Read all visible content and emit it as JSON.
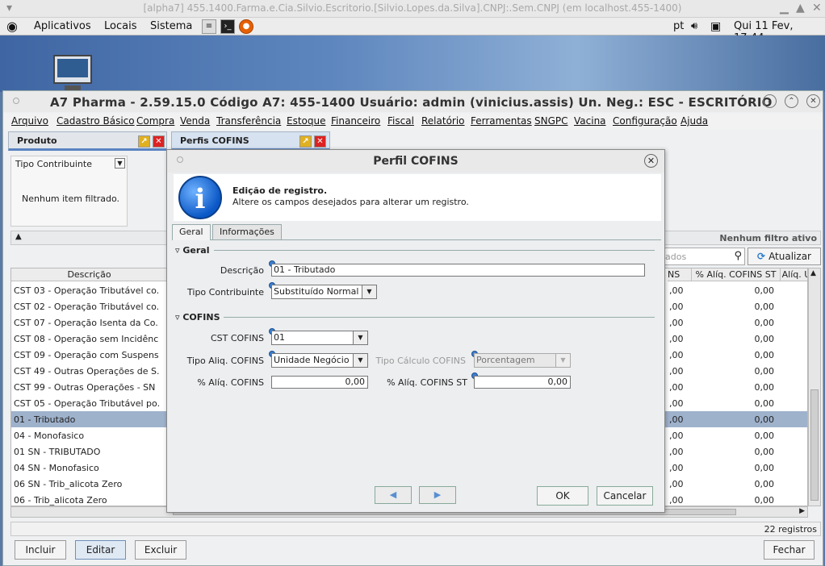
{
  "os": {
    "window_title": "[alpha7] 455.1400.Farma.e.Cia.Silvio.Escritorio.[Silvio.Lopes.da.Silva].CNPJ:.Sem.CNPJ (em localhost.455-1400)",
    "panel": {
      "menu_apps": "Aplicativos",
      "menu_places": "Locais",
      "menu_system": "Sistema",
      "lang": "pt",
      "clock": "Qui 11 Fev, 17:44"
    }
  },
  "app": {
    "title": "A7 Pharma - 2.59.15.0   Código A7: 455-1400   Usuário: admin (vinicius.assis)   Un. Neg.: ESC - ESCRITÓRIO",
    "menu": [
      "Arquivo",
      "Cadastro Básico",
      "Compra",
      "Venda",
      "Transferência",
      "Estoque",
      "Financeiro",
      "Fiscal",
      "Relatório",
      "Ferramentas",
      "SNGPC",
      "Vacina",
      "Configuração",
      "Ajuda"
    ],
    "tabs": [
      "Produto",
      "Perfis  COFINS"
    ],
    "filter": {
      "header": "Tipo Contribuinte",
      "message": "Nenhum item filtrado."
    },
    "no_filter": "Nenhum filtro ativo",
    "search_placeholder": "ados",
    "refresh_label": "Atualizar",
    "columns": {
      "descricao": "Descrição",
      "ns": "NS",
      "aliq_st": "% Alíq. COFINS ST",
      "aliq_u": "Alíq. U"
    },
    "rows": [
      {
        "desc": "CST 03 - Operação Tributável co...",
        "c2": ",00",
        "c3": "0,00"
      },
      {
        "desc": "CST 02 - Operação Tributável co...",
        "c2": ",00",
        "c3": "0,00"
      },
      {
        "desc": "CST 07 - Operação Isenta da Co...",
        "c2": ",00",
        "c3": "0,00"
      },
      {
        "desc": "CST 08 - Operação sem Incidênc...",
        "c2": ",00",
        "c3": "0,00"
      },
      {
        "desc": "CST 09 - Operação com Suspens...",
        "c2": ",00",
        "c3": "0,00"
      },
      {
        "desc": "CST 49 - Outras Operações de S...",
        "c2": ",00",
        "c3": "0,00"
      },
      {
        "desc": "CST 99 - Outras Operações - SN",
        "c2": ",00",
        "c3": "0,00"
      },
      {
        "desc": "CST 05 - Operação Tributável po...",
        "c2": ",00",
        "c3": "0,00"
      },
      {
        "desc": "01 - Tributado",
        "c2": ",00",
        "c3": "0,00"
      },
      {
        "desc": "04 - Monofasico",
        "c2": ",00",
        "c3": "0,00"
      },
      {
        "desc": "01 SN - TRIBUTADO",
        "c2": ",00",
        "c3": "0,00"
      },
      {
        "desc": "04 SN - Monofasico",
        "c2": ",00",
        "c3": "0,00"
      },
      {
        "desc": "06 SN - Trib_alicota Zero",
        "c2": ",00",
        "c3": "0,00"
      },
      {
        "desc": "06 - Trib_alicota Zero",
        "c2": ",00",
        "c3": "0,00"
      }
    ],
    "selected_row": 8,
    "record_count": "22 registros",
    "buttons": {
      "incluir": "Incluir",
      "editar": "Editar",
      "excluir": "Excluir",
      "fechar": "Fechar"
    }
  },
  "dialog": {
    "title": "Perfil COFINS",
    "info_heading": "Edição de registro.",
    "info_sub": "Altere os campos desejados para alterar um registro.",
    "tabs": [
      "Geral",
      "Informações"
    ],
    "section_geral": "Geral",
    "section_cofins": "COFINS",
    "labels": {
      "descricao": "Descrição",
      "tipo_contribuinte": "Tipo Contribuinte",
      "cst_cofins": "CST COFINS",
      "tipo_aliq": "Tipo Aliq. COFINS",
      "tipo_calculo": "Tipo Cálculo COFINS",
      "aliq": "% Alíq. COFINS",
      "aliq_st": "% Alíq. COFINS ST"
    },
    "values": {
      "descricao": "01 - Tributado",
      "tipo_contribuinte": "Substituído Normal",
      "cst_cofins": "01",
      "tipo_aliq": "Unidade Negócio",
      "tipo_calculo": "Porcentagem",
      "aliq": "0,00",
      "aliq_st": "0,00"
    },
    "ok": "OK",
    "cancel": "Cancelar"
  }
}
